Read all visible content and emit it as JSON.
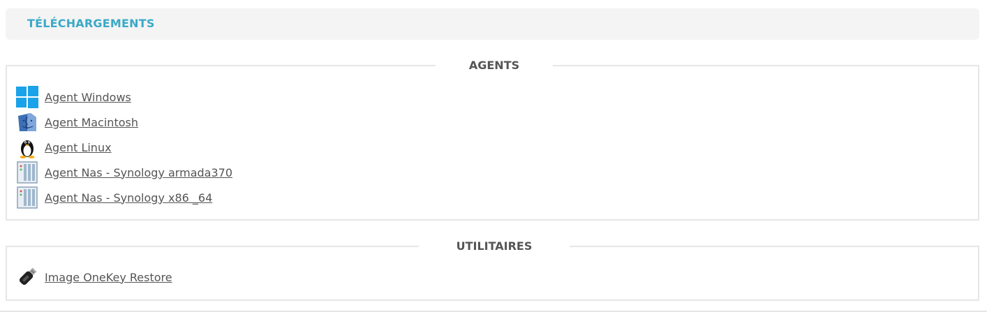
{
  "header": {
    "title": "TÉLÉCHARGEMENTS"
  },
  "agents": {
    "legend": "AGENTS",
    "items": [
      {
        "label": "Agent Windows",
        "icon": "windows-icon"
      },
      {
        "label": "Agent Macintosh",
        "icon": "macintosh-icon"
      },
      {
        "label": "Agent Linux",
        "icon": "linux-icon"
      },
      {
        "label": "Agent Nas - Synology armada370",
        "icon": "nas-icon"
      },
      {
        "label": "Agent Nas - Synology x86 _64",
        "icon": "nas-icon"
      }
    ]
  },
  "utilities": {
    "legend": "UTILITAIRES",
    "items": [
      {
        "label": "Image OneKey Restore",
        "icon": "usb-key-icon"
      }
    ]
  },
  "colors": {
    "title": "#3aa9c8",
    "text": "#555555",
    "border": "#e6e6e6",
    "header_bg": "#f4f4f4",
    "windows": "#1aa3e8"
  }
}
